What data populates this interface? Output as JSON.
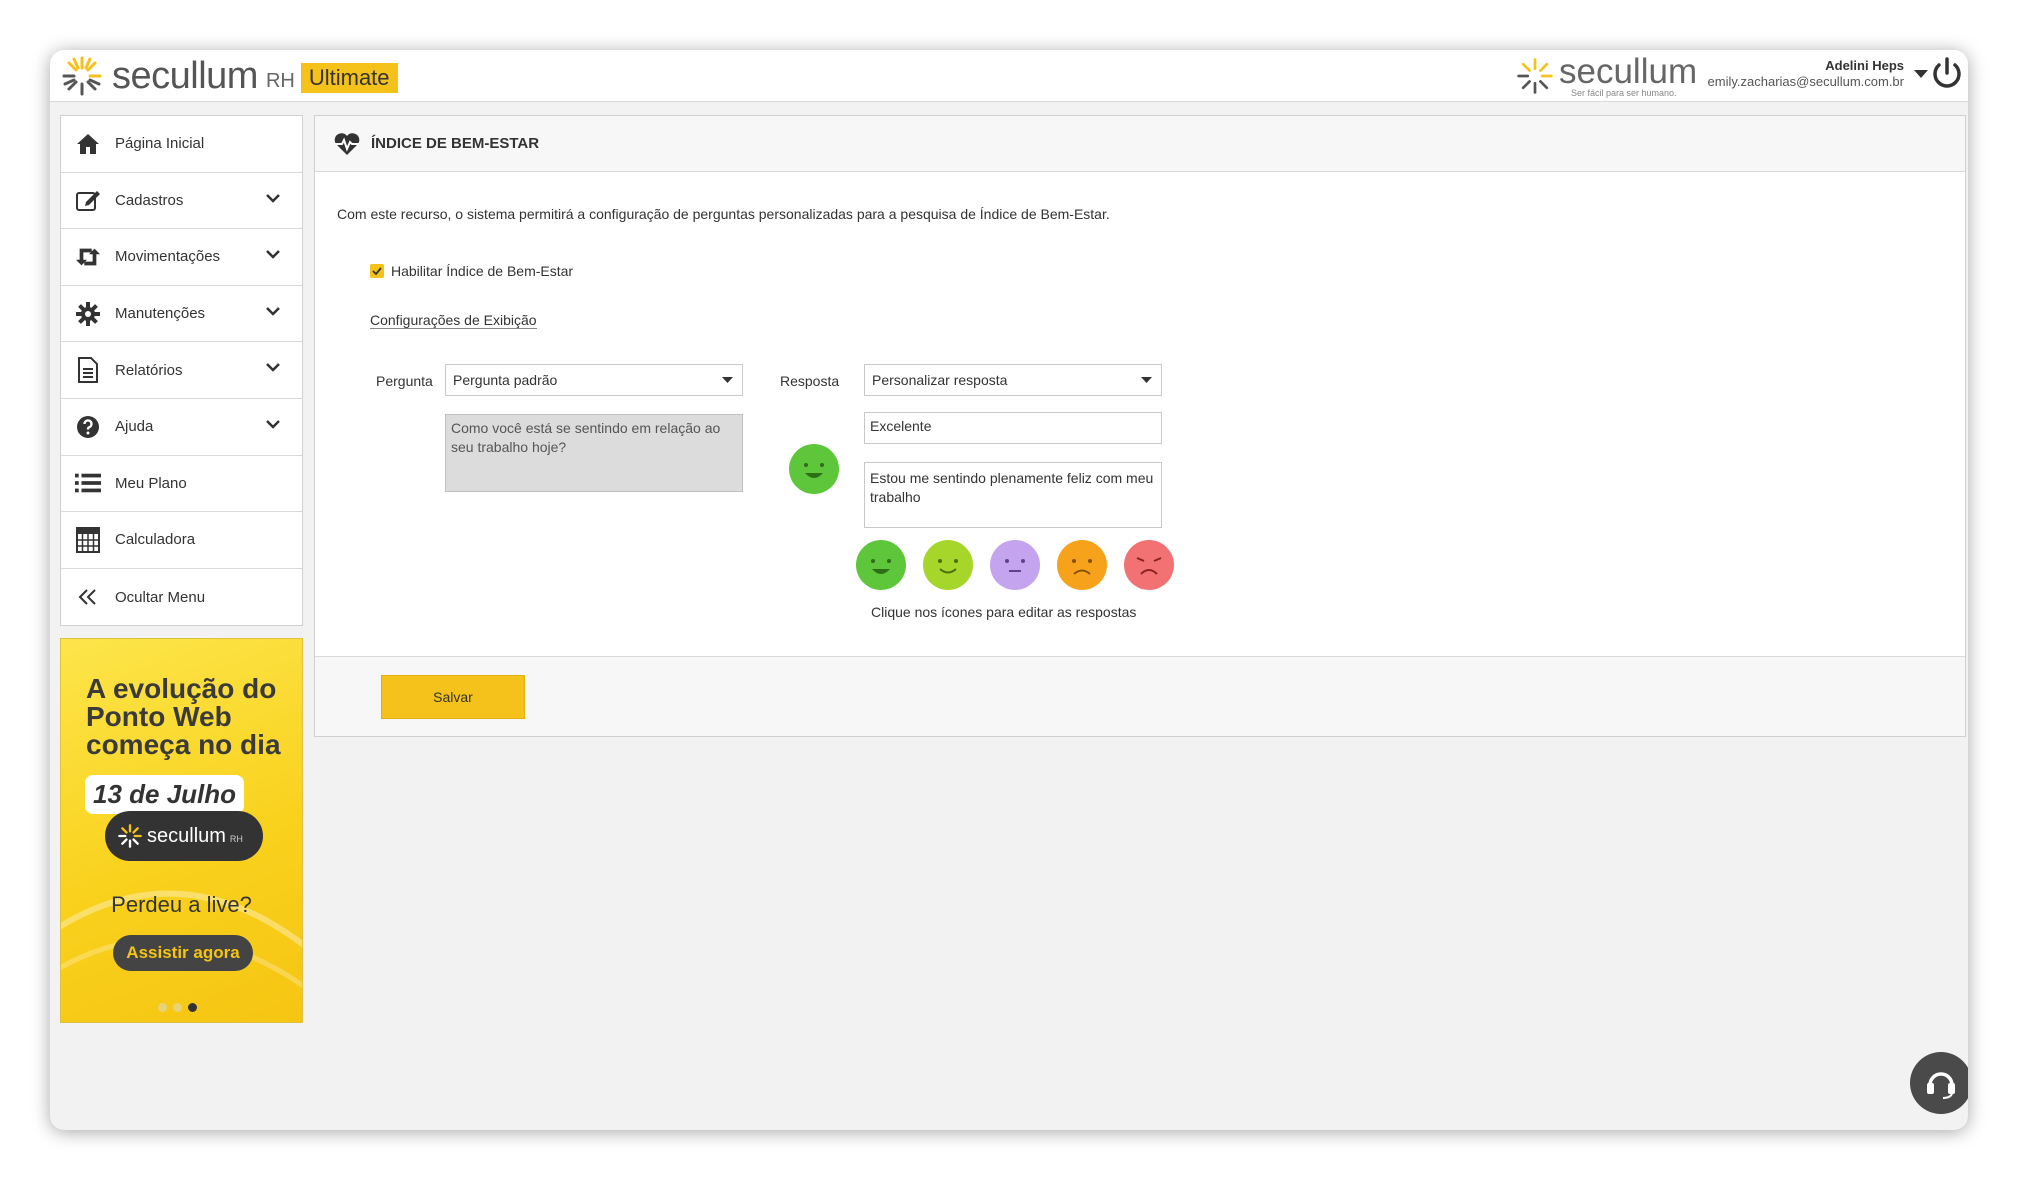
{
  "header": {
    "logo_text": "secullum",
    "logo_rh": "RH",
    "logo_badge": "Ultimate",
    "brand_name": "secullum",
    "brand_tagline": "Ser fácil para ser humano.",
    "user_name": "Adelini Heps",
    "user_email": "emily.zacharias@secullum.com.br"
  },
  "sidebar": {
    "items": [
      {
        "label": "Página Inicial",
        "icon": "home-icon"
      },
      {
        "label": "Cadastros",
        "icon": "edit-icon",
        "expandable": true
      },
      {
        "label": "Movimentações",
        "icon": "swap-icon",
        "expandable": true
      },
      {
        "label": "Manutenções",
        "icon": "gear-icon",
        "expandable": true
      },
      {
        "label": "Relatórios",
        "icon": "document-icon",
        "expandable": true
      },
      {
        "label": "Ajuda",
        "icon": "help-icon",
        "expandable": true
      },
      {
        "label": "Meu Plano",
        "icon": "list-icon"
      },
      {
        "label": "Calculadora",
        "icon": "calculator-icon"
      },
      {
        "label": "Ocultar Menu",
        "icon": "double-chevron-left-icon"
      }
    ]
  },
  "banner": {
    "title": "A evolução do Ponto Web começa no dia",
    "date": "13 de Julho",
    "pill_text": "secullum",
    "pill_rh": "RH",
    "question": "Perdeu a live?",
    "cta": "Assistir agora",
    "slides": 3,
    "active_slide": 3
  },
  "panel": {
    "title": "ÍNDICE DE BEM-ESTAR",
    "description": "Com este recurso, o sistema permitirá a configuração de perguntas personalizadas para a pesquisa de Índice de Bem-Estar.",
    "enable_label": "Habilitar Índice de Bem-Estar",
    "enable_checked": true,
    "config_link": "Configurações de Exibição",
    "question_label": "Pergunta",
    "question_select": "Pergunta padrão",
    "question_text": "Como você está se sentindo em relação ao seu trabalho hoje?",
    "answer_label": "Resposta",
    "answer_select": "Personalizar resposta",
    "answer_title": "Excelente",
    "answer_text": "Estou me sentindo plenamente feliz com meu trabalho",
    "faces_hint": "Clique nos ícones para editar as respostas",
    "face_colors": [
      "#5ec63a",
      "#a7d62a",
      "#c4a3ef",
      "#f7a21b",
      "#f27274"
    ],
    "save_label": "Salvar"
  },
  "colors": {
    "accent": "#f4c21b",
    "dark": "#333333"
  }
}
